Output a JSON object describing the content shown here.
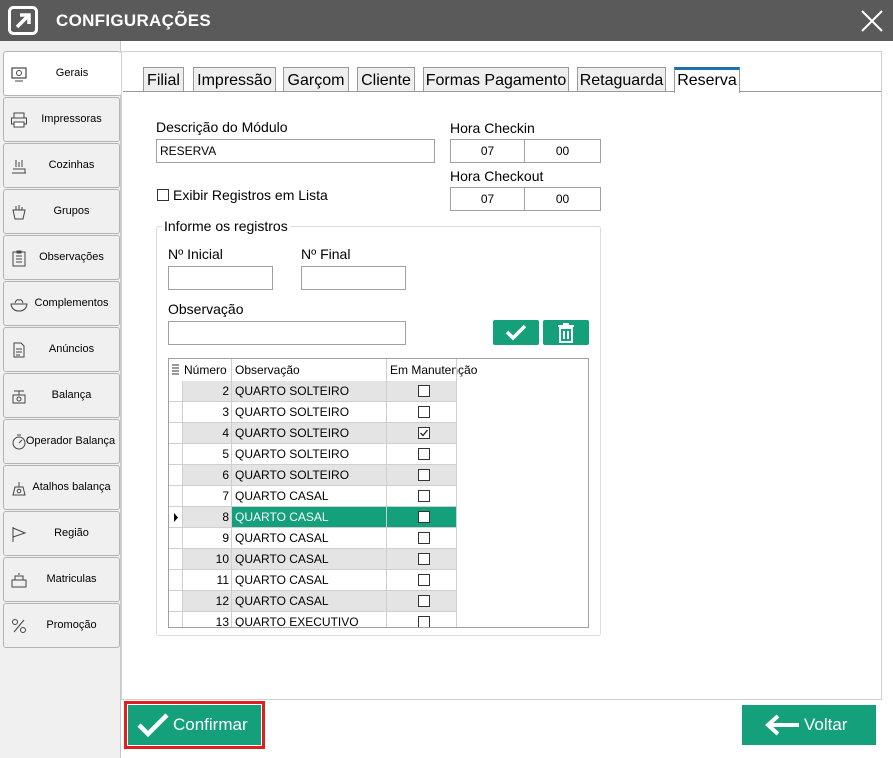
{
  "window": {
    "title": "CONFIGURAÇÕES"
  },
  "sidebar": {
    "items": [
      {
        "label": "Gerais",
        "icon": "gear-monitor-icon",
        "active": true
      },
      {
        "label": "Impressoras",
        "icon": "printer-icon"
      },
      {
        "label": "Cozinhas",
        "icon": "kitchen-icon"
      },
      {
        "label": "Grupos",
        "icon": "groups-icon"
      },
      {
        "label": "Observações",
        "icon": "clipboard-icon"
      },
      {
        "label": "Complementos",
        "icon": "bowl-icon"
      },
      {
        "label": "Anúncios",
        "icon": "document-icon"
      },
      {
        "label": "Balança",
        "icon": "scale-icon"
      },
      {
        "label": "Operador  Balança",
        "icon": "operator-scale-icon"
      },
      {
        "label": "Atalhos balança",
        "icon": "shortcut-scale-icon"
      },
      {
        "label": "Região",
        "icon": "flag-icon"
      },
      {
        "label": "Matriculas",
        "icon": "register-icon"
      },
      {
        "label": "Promoção",
        "icon": "promotion-icon"
      }
    ]
  },
  "tabs": [
    {
      "label": "Filial"
    },
    {
      "label": "Impressão"
    },
    {
      "label": "Garçom"
    },
    {
      "label": "Cliente"
    },
    {
      "label": "Formas Pagamento"
    },
    {
      "label": "Retaguarda"
    },
    {
      "label": "Reserva",
      "active": true
    }
  ],
  "form": {
    "descricao_label": "Descrição do Módulo",
    "descricao_value": "RESERVA",
    "exibir_label": "Exibir Registros em Lista",
    "exibir_checked": false,
    "checkin_label": "Hora Checkin",
    "checkin_hour": "07",
    "checkin_min": "00",
    "checkout_label": "Hora Checkout",
    "checkout_hour": "07",
    "checkout_min": "00"
  },
  "registros": {
    "group_label": "Informe os registros",
    "inicial_label": "Nº Inicial",
    "inicial_value": "",
    "final_label": "Nº Final",
    "final_value": "",
    "obs_label": "Observação",
    "obs_value": ""
  },
  "grid": {
    "columns": [
      "Número",
      "Observação",
      "Em Manutenção"
    ],
    "rows": [
      {
        "num": "2",
        "obs": "QUARTO SOLTEIRO",
        "manut": false
      },
      {
        "num": "3",
        "obs": "QUARTO SOLTEIRO",
        "manut": false
      },
      {
        "num": "4",
        "obs": "QUARTO SOLTEIRO",
        "manut": true
      },
      {
        "num": "5",
        "obs": "QUARTO SOLTEIRO",
        "manut": false
      },
      {
        "num": "6",
        "obs": "QUARTO SOLTEIRO",
        "manut": false
      },
      {
        "num": "7",
        "obs": "QUARTO CASAL",
        "manut": false
      },
      {
        "num": "8",
        "obs": "QUARTO CASAL",
        "manut": false,
        "selected": true
      },
      {
        "num": "9",
        "obs": "QUARTO CASAL",
        "manut": false
      },
      {
        "num": "10",
        "obs": "QUARTO CASAL",
        "manut": false
      },
      {
        "num": "11",
        "obs": "QUARTO CASAL",
        "manut": false
      },
      {
        "num": "12",
        "obs": "QUARTO CASAL",
        "manut": false
      },
      {
        "num": "13",
        "obs": "QUARTO EXECUTIVO",
        "manut": false
      }
    ]
  },
  "footer": {
    "confirm_label": "Confirmar",
    "back_label": "Voltar"
  },
  "colors": {
    "accent": "#14a07a",
    "titlebar": "#5a5a5a",
    "tab_active": "#1e6fb0",
    "highlight": "#e02020"
  }
}
